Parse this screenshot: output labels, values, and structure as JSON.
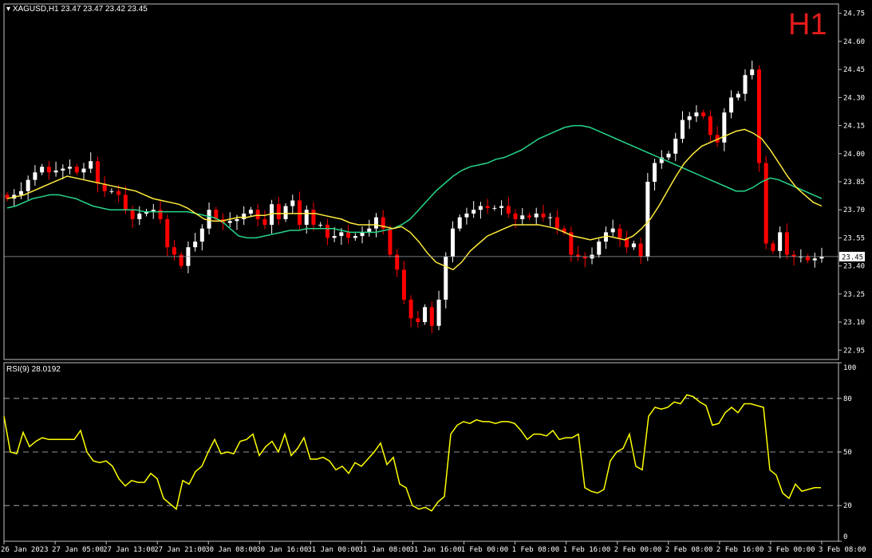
{
  "header": {
    "symbol_line": "XAGUSD,H1  23.47 23.47 23.42 23.45",
    "timeframe_badge": "H1",
    "rsi_label": "RSI(9) 28.0192"
  },
  "colors": {
    "background": "#000000",
    "bull": "#ffffff",
    "bear": "#ff0000",
    "ma_fast": "#ffeb3b",
    "ma_slow": "#26d68a",
    "rsi": "#ffff00",
    "grid": "#c0c0c0",
    "frame": "#c0c0c0",
    "badge": "#e31b1b"
  },
  "chart_data": [
    {
      "type": "candlestick",
      "symbol": "XAGUSD",
      "timeframe": "H1",
      "ylim": [
        22.9,
        24.8
      ],
      "y_ticks": [
        "24.75",
        "24.60",
        "24.45",
        "24.30",
        "24.15",
        "24.00",
        "23.85",
        "23.70",
        "23.55",
        "23.40",
        "23.25",
        "23.10",
        "22.95"
      ],
      "current_price": "23.45",
      "x_ticks": [
        "26 Jan 2023",
        "27 Jan 05:00",
        "27 Jan 13:00",
        "27 Jan 21:00",
        "30 Jan 08:00",
        "30 Jan 16:00",
        "31 Jan 00:00",
        "31 Jan 08:00",
        "31 Jan 16:00",
        "1 Feb 00:00",
        "1 Feb 08:00",
        "1 Feb 16:00",
        "2 Feb 00:00",
        "2 Feb 08:00",
        "2 Feb 16:00",
        "3 Feb 00:00",
        "3 Feb 08:00"
      ],
      "closes": [
        23.76,
        23.78,
        23.8,
        23.86,
        23.9,
        23.93,
        23.9,
        23.91,
        23.92,
        23.93,
        23.9,
        23.92,
        23.96,
        23.84,
        23.8,
        23.8,
        23.78,
        23.7,
        23.65,
        23.68,
        23.69,
        23.7,
        23.65,
        23.5,
        23.46,
        23.4,
        23.5,
        23.53,
        23.6,
        23.7,
        23.65,
        23.63,
        23.64,
        23.65,
        23.68,
        23.7,
        23.65,
        23.62,
        23.73,
        23.65,
        23.72,
        23.75,
        23.62,
        23.7,
        23.62,
        23.62,
        23.55,
        23.56,
        23.58,
        23.55,
        23.56,
        23.58,
        23.6,
        23.66,
        23.6,
        23.46,
        23.38,
        23.22,
        23.12,
        23.1,
        23.18,
        23.08,
        23.22,
        23.45,
        23.6,
        23.66,
        23.68,
        23.7,
        23.72,
        23.71,
        23.71,
        23.72,
        23.68,
        23.65,
        23.67,
        23.66,
        23.68,
        23.66,
        23.66,
        23.6,
        23.58,
        23.46,
        23.45,
        23.44,
        23.46,
        23.53,
        23.58,
        23.6,
        23.55,
        23.5,
        23.52,
        23.45,
        23.85,
        23.95,
        23.98,
        24.0,
        24.08,
        24.18,
        24.2,
        24.22,
        24.2,
        24.1,
        24.06,
        24.22,
        24.3,
        24.32,
        24.42,
        24.45,
        23.95,
        23.52,
        23.48,
        23.58,
        23.46,
        23.45,
        23.45,
        23.43,
        23.44,
        23.45
      ],
      "ma_fast": [
        23.76,
        23.77,
        23.78,
        23.8,
        23.82,
        23.84,
        23.86,
        23.88,
        23.87,
        23.86,
        23.85,
        23.84,
        23.83,
        23.82,
        23.81,
        23.8,
        23.78,
        23.76,
        23.75,
        23.74,
        23.73,
        23.71,
        23.68,
        23.65,
        23.64,
        23.64,
        23.65,
        23.66,
        23.66,
        23.67,
        23.67,
        23.68,
        23.68,
        23.68,
        23.68,
        23.68,
        23.68,
        23.67,
        23.66,
        23.65,
        23.63,
        23.62,
        23.62,
        23.62,
        23.61,
        23.6,
        23.61,
        23.58,
        23.53,
        23.47,
        23.42,
        23.4,
        23.38,
        23.42,
        23.48,
        23.52,
        23.56,
        23.58,
        23.6,
        23.62,
        23.62,
        23.62,
        23.62,
        23.61,
        23.6,
        23.58,
        23.56,
        23.55,
        23.54,
        23.55,
        23.56,
        23.55,
        23.54,
        23.56,
        23.6,
        23.65,
        23.72,
        23.8,
        23.88,
        23.95,
        24.0,
        24.04,
        24.06,
        24.08,
        24.1,
        24.12,
        24.13,
        24.11,
        24.08,
        24.02,
        23.95,
        23.88,
        23.82,
        23.78,
        23.74,
        23.72
      ],
      "ma_slow": [
        23.71,
        23.72,
        23.74,
        23.76,
        23.77,
        23.78,
        23.78,
        23.77,
        23.76,
        23.74,
        23.72,
        23.71,
        23.7,
        23.7,
        23.7,
        23.7,
        23.69,
        23.69,
        23.69,
        23.69,
        23.69,
        23.69,
        23.68,
        23.67,
        23.66,
        23.64,
        23.6,
        23.56,
        23.55,
        23.55,
        23.56,
        23.57,
        23.58,
        23.59,
        23.59,
        23.6,
        23.6,
        23.6,
        23.6,
        23.59,
        23.58,
        23.58,
        23.58,
        23.58,
        23.59,
        23.6,
        23.62,
        23.65,
        23.7,
        23.75,
        23.8,
        23.84,
        23.88,
        23.91,
        23.93,
        23.94,
        23.95,
        23.97,
        23.98,
        24.0,
        24.02,
        24.05,
        24.08,
        24.1,
        24.12,
        24.14,
        24.15,
        24.15,
        24.14,
        24.12,
        24.1,
        24.08,
        24.06,
        24.04,
        24.02,
        24.0,
        23.98,
        23.96,
        23.94,
        23.92,
        23.9,
        23.88,
        23.86,
        23.84,
        23.82,
        23.8,
        23.8,
        23.82,
        23.85,
        23.87,
        23.86,
        23.84,
        23.82,
        23.8,
        23.78,
        23.76
      ]
    },
    {
      "type": "line",
      "name": "RSI(9)",
      "ylim": [
        0,
        100
      ],
      "y_ticks": [
        "100",
        "80",
        "50",
        "20",
        "0"
      ],
      "levels": [
        20,
        50,
        80
      ],
      "values": [
        70,
        50,
        49,
        61,
        53,
        56,
        58,
        57,
        57,
        57,
        57,
        57,
        62,
        50,
        45,
        44,
        45,
        42,
        35,
        31,
        34,
        33,
        33,
        38,
        35,
        24,
        21,
        18,
        34,
        32,
        39,
        42,
        50,
        57,
        49,
        50,
        49,
        56,
        57,
        60,
        48,
        53,
        56,
        50,
        60,
        48,
        52,
        58,
        46,
        46,
        47,
        45,
        40,
        42,
        38,
        44,
        42,
        46,
        50,
        55,
        43,
        47,
        32,
        30,
        20,
        18,
        19,
        17,
        22,
        25,
        60,
        65,
        67,
        66,
        68,
        67,
        67,
        66,
        67,
        67,
        66,
        62,
        57,
        60,
        60,
        59,
        62,
        57,
        58,
        58,
        60,
        30,
        28,
        27,
        29,
        45,
        50,
        52,
        60,
        42,
        40,
        70,
        75,
        74,
        75,
        78,
        77,
        82,
        81,
        78,
        76,
        65,
        66,
        72,
        75,
        72,
        77,
        77,
        76,
        75,
        40,
        37,
        27,
        24,
        32,
        28,
        29,
        30,
        30
      ],
      "current": "28.0192"
    }
  ]
}
